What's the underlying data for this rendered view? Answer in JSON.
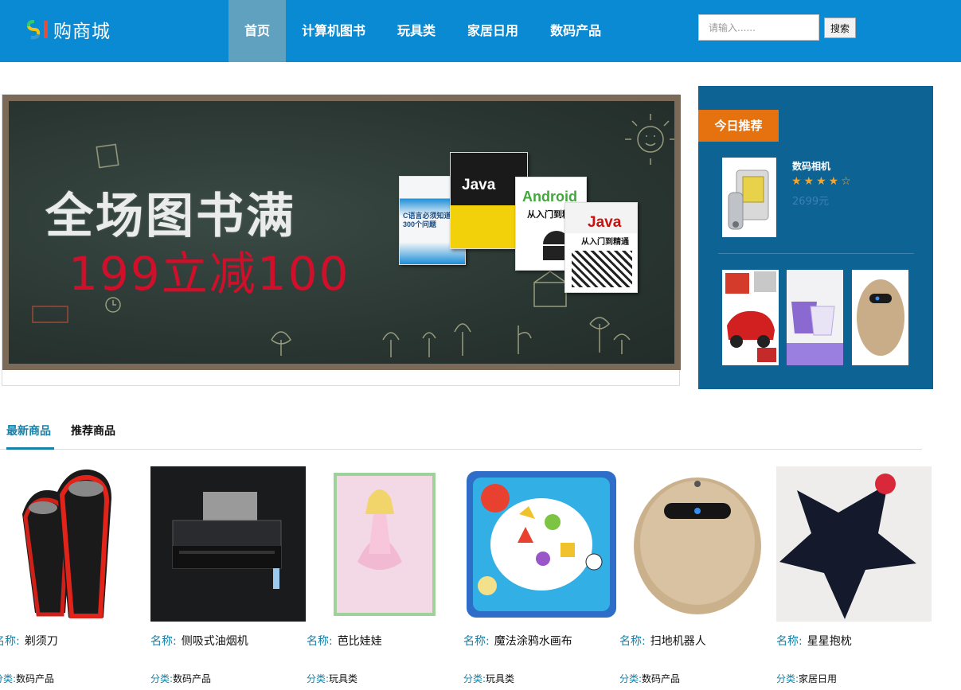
{
  "header": {
    "logo_text": "购商城",
    "nav": [
      "首页",
      "计算机图书",
      "玩具类",
      "家居日用",
      "数码产品"
    ],
    "search_placeholder": "请输入......",
    "search_button": "搜索"
  },
  "banner": {
    "title": "全场图书满",
    "subtitle": "199立减100",
    "books": [
      {
        "title": "C语言必须知道的300个问题"
      },
      {
        "title": "Java"
      },
      {
        "title": "Android",
        "subtitle": "从入门到精通"
      },
      {
        "title": "Java",
        "subtitle": "从入门到精通"
      }
    ]
  },
  "recommend": {
    "tag": "今日推荐",
    "featured": {
      "name": "数码相机",
      "rating": 4,
      "max_rating": 5,
      "stars": "★★★★☆",
      "price": "2699元"
    },
    "thumbs": [
      "toy-car",
      "bucket",
      "robot-vacuum"
    ]
  },
  "tabs": {
    "items": [
      {
        "label": "最新商品",
        "active": true
      },
      {
        "label": "推荐商品",
        "active": false
      }
    ]
  },
  "products": {
    "name_label": "名称:",
    "category_label": "分类:",
    "items": [
      {
        "name": "剃须刀",
        "category": "数码产品"
      },
      {
        "name": "侧吸式油烟机",
        "category": "数码产品"
      },
      {
        "name": "芭比娃娃",
        "category": "玩具类"
      },
      {
        "name": "魔法涂鸦水画布",
        "category": "玩具类"
      },
      {
        "name": "扫地机器人",
        "category": "数码产品"
      },
      {
        "name": "星星抱枕",
        "category": "家居日用"
      }
    ]
  },
  "colors": {
    "header_bg": "#0a8ad2",
    "nav_active": "#5fa1bf",
    "recommend_bg": "#0c6394",
    "recommend_tag": "#e5720f",
    "accent": "#1581a9"
  }
}
